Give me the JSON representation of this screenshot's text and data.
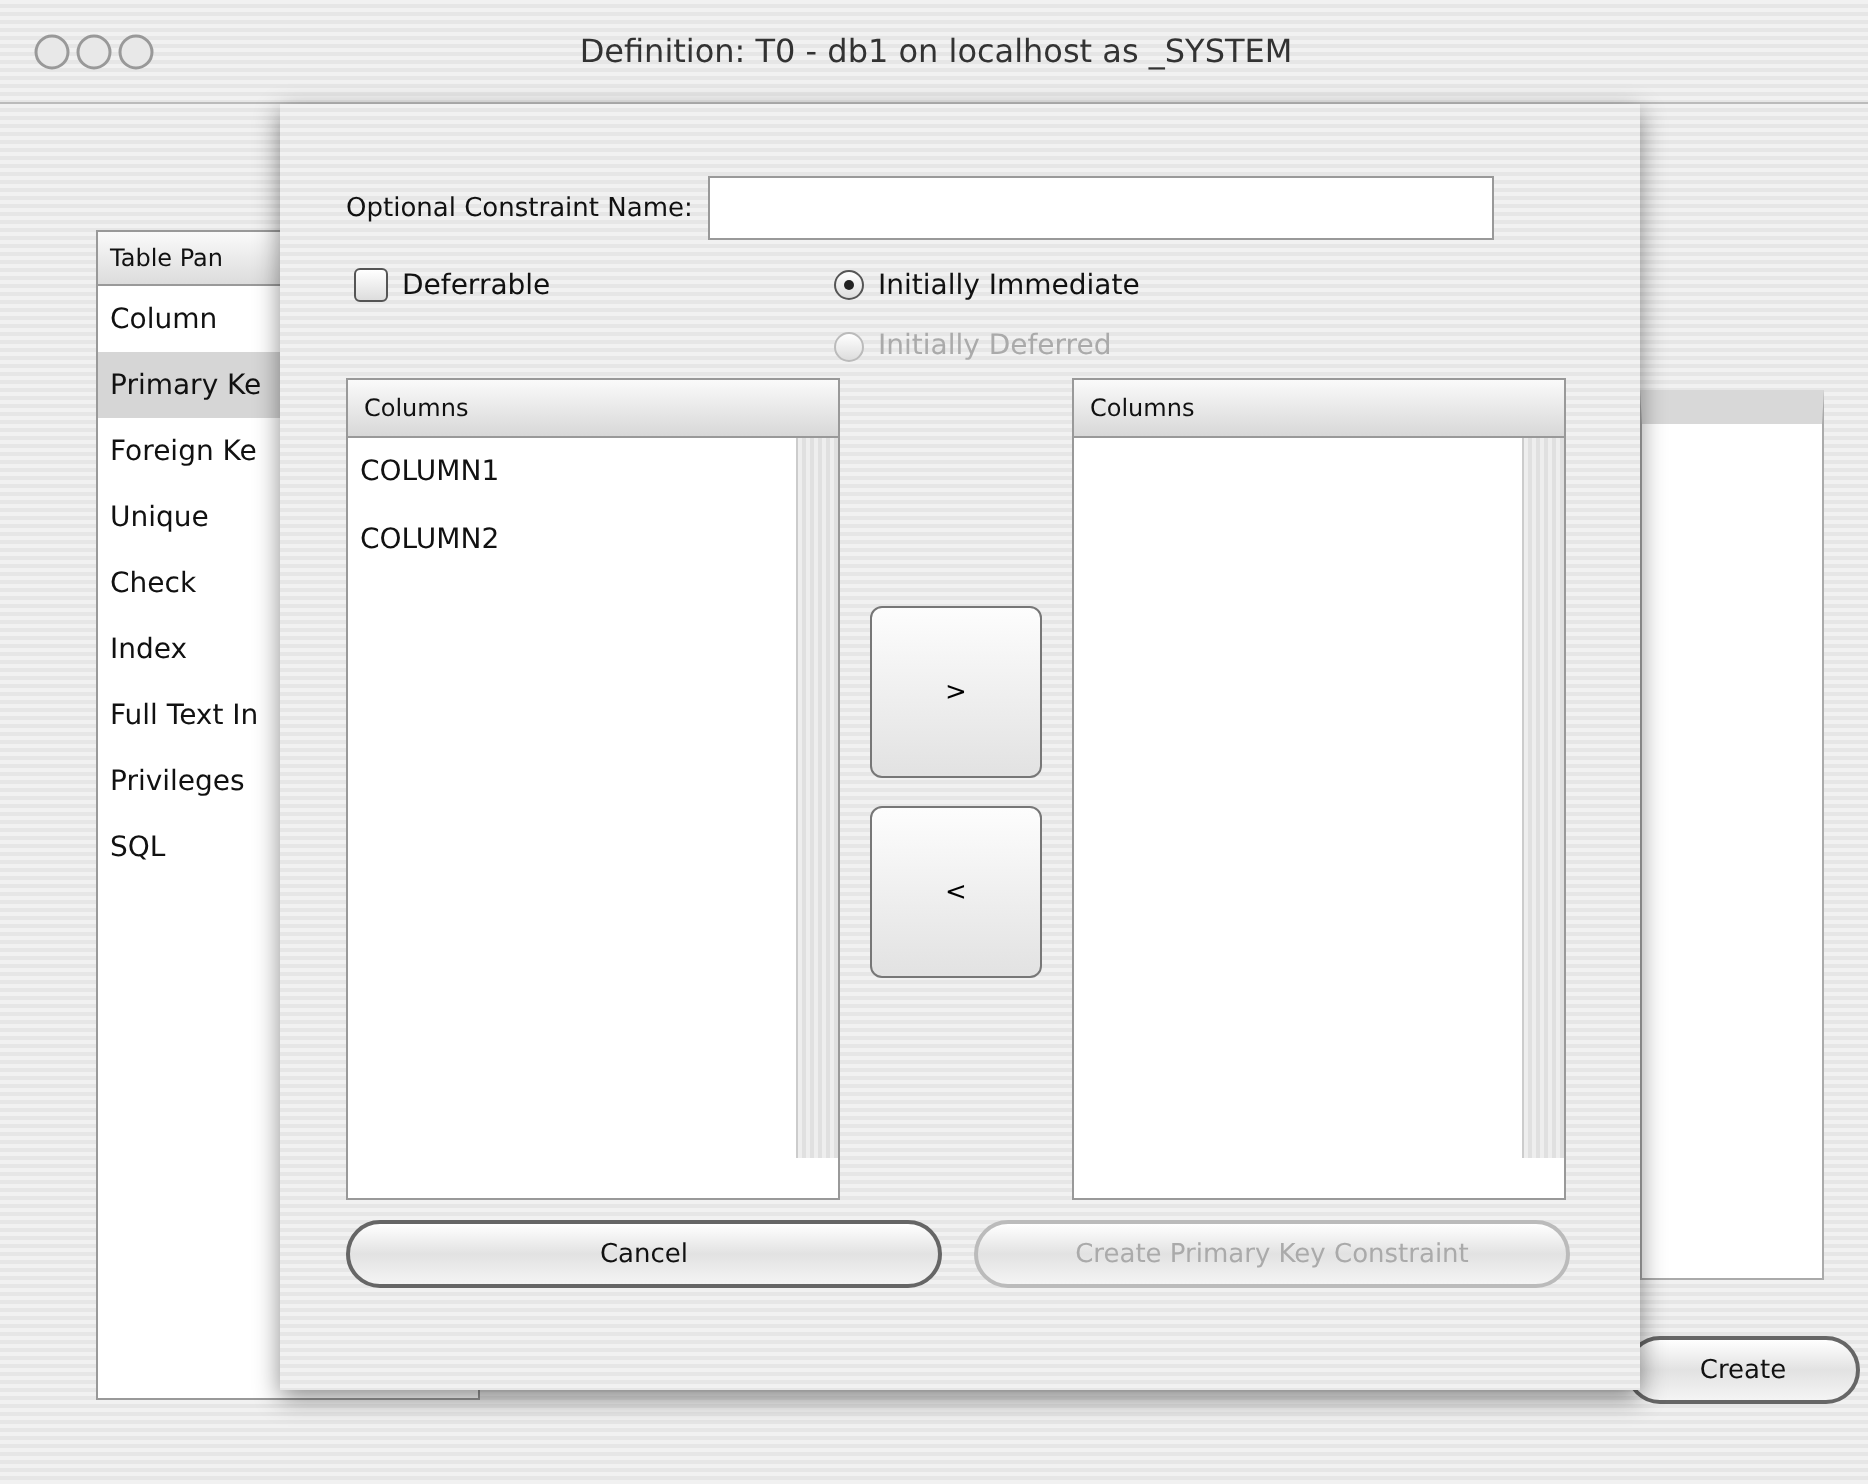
{
  "window": {
    "title": "Definition: T0 - db1 on localhost as _SYSTEM"
  },
  "sidebar": {
    "header": "Table Pan",
    "items": [
      {
        "label": "Column",
        "selected": false
      },
      {
        "label": "Primary Ke",
        "selected": true
      },
      {
        "label": "Foreign Ke",
        "selected": false
      },
      {
        "label": "Unique",
        "selected": false
      },
      {
        "label": "Check",
        "selected": false
      },
      {
        "label": "Index",
        "selected": false
      },
      {
        "label": "Full Text In",
        "selected": false
      },
      {
        "label": "Privileges",
        "selected": false
      },
      {
        "label": "SQL",
        "selected": false
      }
    ]
  },
  "background_button": {
    "label": "Create"
  },
  "sheet": {
    "name_label": "Optional Constraint Name:",
    "deferrable": {
      "label": "Deferrable",
      "checked": false
    },
    "radios": [
      {
        "label": "Initially Immediate",
        "selected": true,
        "disabled": false
      },
      {
        "label": "Initially Deferred",
        "selected": false,
        "disabled": true
      }
    ],
    "available": {
      "header": "Columns",
      "items": [
        "COLUMN1",
        "COLUMN2"
      ]
    },
    "chosen": {
      "header": "Columns"
    },
    "move_buttons": [
      ">",
      "<"
    ],
    "buttons": [
      {
        "label": "Cancel",
        "disabled": false
      },
      {
        "label": "Create Primary Key Constraint",
        "disabled": true
      }
    ]
  }
}
